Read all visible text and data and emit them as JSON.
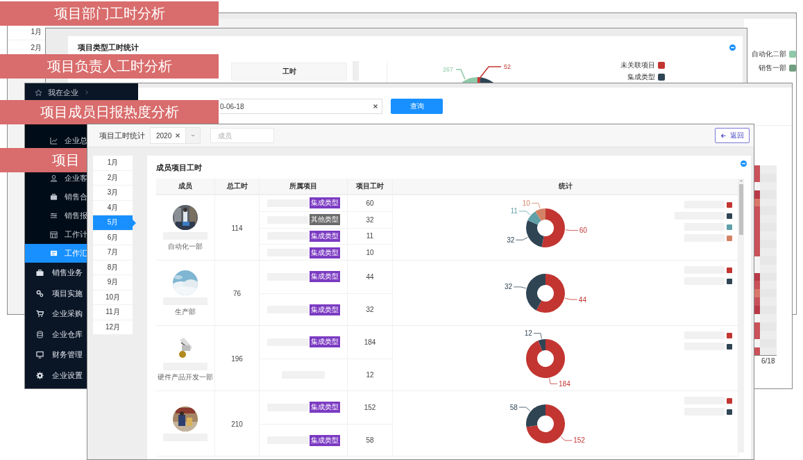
{
  "banners": [
    {
      "text": "项目部门工时分析"
    },
    {
      "text": "项目负责人工时分析"
    },
    {
      "text": "项目成员日报热度分析"
    },
    {
      "text": "项目"
    }
  ],
  "dept_window": {
    "months": [
      "1月",
      "2月"
    ],
    "legend": [
      {
        "label": "自动化二部",
        "color": "#8fc9a9"
      },
      {
        "label": "销售一部",
        "color": "#6f9f80"
      }
    ]
  },
  "type_window": {
    "title": "项目类型工时统计",
    "column_header": "工时",
    "pie_labels": [
      {
        "text": "267",
        "color": "#8fc9a9"
      },
      {
        "text": "52",
        "color": "#c23531"
      }
    ],
    "legend": [
      {
        "label": "未关联项目",
        "color": "#c23531"
      },
      {
        "label": "集成类型",
        "color": "#2f4554"
      }
    ]
  },
  "report_window": {
    "sidebar": [
      {
        "label": "我在企业",
        "selected": false,
        "children": [
          {
            "label": "企业总",
            "selected": false
          },
          {
            "label": "企业客",
            "selected": false
          },
          {
            "label": "销售合",
            "selected": false
          },
          {
            "label": "销售报",
            "selected": false
          },
          {
            "label": "工作计",
            "selected": false
          },
          {
            "label": "工作汇",
            "selected": true
          }
        ]
      },
      {
        "label": "销售业务",
        "selected": false
      },
      {
        "label": "项目实施",
        "selected": false
      },
      {
        "label": "企业采购",
        "selected": false
      },
      {
        "label": "企业仓库",
        "selected": false
      },
      {
        "label": "财务管理",
        "selected": false
      },
      {
        "label": "企业设置",
        "selected": false
      }
    ],
    "date_value": "0-06-18",
    "query_button": "查询",
    "heatmap_label": "6/18",
    "heatmap": [
      {
        "color": "#c9515a"
      },
      {
        "color": "#c9515a"
      },
      {
        "color": "#f4f4f4"
      },
      {
        "color": "#b83a48"
      },
      {
        "color": "#d9776b"
      },
      {
        "color": "#c9515a"
      },
      {
        "color": "#c9515a"
      },
      {
        "color": "#c9515a"
      },
      {
        "color": "#c9515a"
      },
      {
        "color": "#c9515a"
      },
      {
        "color": "#c9515a"
      },
      {
        "color": "#f4f4f4"
      },
      {
        "color": "#f4f4f4"
      },
      {
        "color": "#b83a48"
      },
      {
        "color": "#c9515a"
      },
      {
        "color": "#d9776b"
      },
      {
        "color": "#c9515a"
      },
      {
        "color": "#b83a48"
      },
      {
        "color": "#f4f4f4"
      },
      {
        "color": "#c9515a"
      },
      {
        "color": "#c9515a"
      },
      {
        "color": "#f4f4f4"
      },
      {
        "color": "#c9515a"
      }
    ]
  },
  "stats_window": {
    "title": "项目工时统计",
    "year_select": "2020",
    "member_placeholder": "成员",
    "back_button": "返回",
    "months": [
      {
        "label": "1月",
        "selected": false
      },
      {
        "label": "2月",
        "selected": false
      },
      {
        "label": "3月",
        "selected": false
      },
      {
        "label": "4月",
        "selected": false
      },
      {
        "label": "5月",
        "selected": true
      },
      {
        "label": "6月",
        "selected": false
      },
      {
        "label": "7月",
        "selected": false
      },
      {
        "label": "8月",
        "selected": false
      },
      {
        "label": "9月",
        "selected": false
      },
      {
        "label": "10月",
        "selected": false
      },
      {
        "label": "11月",
        "selected": false
      },
      {
        "label": "12月",
        "selected": false
      }
    ],
    "card_title": "成员项目工时",
    "columns": [
      "成员",
      "总工时",
      "所属项目",
      "项目工时",
      "统计"
    ],
    "rows": [
      {
        "department": "自动化一部",
        "total": "114",
        "projects": [
          {
            "tag": "集成类型",
            "color": "#7b3ac2",
            "hours": "60"
          },
          {
            "tag": "其他类型",
            "color": "#6b6b6b",
            "hours": "32"
          },
          {
            "tag": "集成类型",
            "color": "#7b3ac2",
            "hours": "11"
          },
          {
            "tag": "集成类型",
            "color": "#7b3ac2",
            "hours": "10"
          }
        ],
        "chart_data": {
          "type": "donut",
          "values": [
            60,
            32,
            11,
            10
          ],
          "colors": [
            "#c23531",
            "#2f4554",
            "#61a0a8",
            "#d48265"
          ],
          "data_labels": true
        }
      },
      {
        "department": "生产部",
        "total": "76",
        "projects": [
          {
            "tag": "集成类型",
            "color": "#7b3ac2",
            "hours": "44"
          },
          {
            "tag": "集成类型",
            "color": "#7b3ac2",
            "hours": "32"
          }
        ],
        "chart_data": {
          "type": "donut",
          "values": [
            44,
            32
          ],
          "colors": [
            "#c23531",
            "#2f4554"
          ],
          "data_labels": true
        }
      },
      {
        "department": "硬件产品开发一部",
        "total": "196",
        "projects": [
          {
            "tag": "集成类型",
            "color": "#7b3ac2",
            "hours": "184"
          },
          {
            "hours": "12"
          }
        ],
        "chart_data": {
          "type": "donut",
          "values": [
            184,
            12
          ],
          "colors": [
            "#c23531",
            "#2f4554"
          ],
          "data_labels": true
        }
      },
      {
        "total": "210",
        "projects": [
          {
            "tag": "集成类型",
            "color": "#7b3ac2",
            "hours": "152"
          },
          {
            "tag": "集成类型",
            "color": "#7b3ac2",
            "hours": "58"
          }
        ],
        "chart_data": {
          "type": "donut",
          "values": [
            152,
            58
          ],
          "colors": [
            "#c23531",
            "#2f4554"
          ],
          "data_labels": true
        }
      }
    ]
  }
}
